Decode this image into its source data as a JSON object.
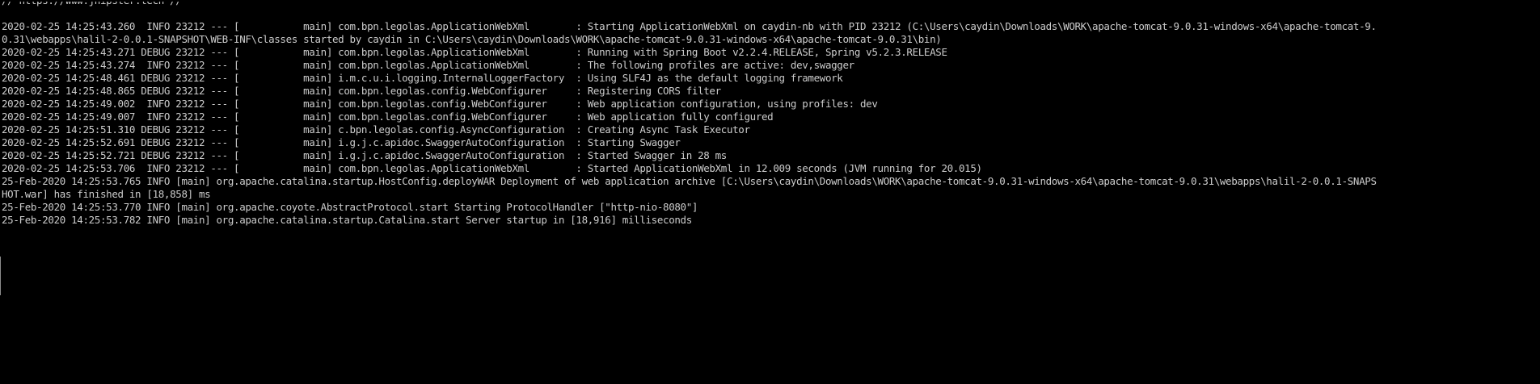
{
  "console": {
    "lines": [
      "// https://www.jhipster.tech //",
      "",
      "2020-02-25 14:25:43.260  INFO 23212 --- [           main] com.bpn.legolas.ApplicationWebXml        : Starting ApplicationWebXml on caydin-nb with PID 23212 (C:\\Users\\caydin\\Downloads\\WORK\\apache-tomcat-9.0.31-windows-x64\\apache-tomcat-9.",
      "0.31\\webapps\\halil-2-0.0.1-SNAPSHOT\\WEB-INF\\classes started by caydin in C:\\Users\\caydin\\Downloads\\WORK\\apache-tomcat-9.0.31-windows-x64\\apache-tomcat-9.0.31\\bin)",
      "2020-02-25 14:25:43.271 DEBUG 23212 --- [           main] com.bpn.legolas.ApplicationWebXml        : Running with Spring Boot v2.2.4.RELEASE, Spring v5.2.3.RELEASE",
      "2020-02-25 14:25:43.274  INFO 23212 --- [           main] com.bpn.legolas.ApplicationWebXml        : The following profiles are active: dev,swagger",
      "2020-02-25 14:25:48.461 DEBUG 23212 --- [           main] i.m.c.u.i.logging.InternalLoggerFactory  : Using SLF4J as the default logging framework",
      "2020-02-25 14:25:48.865 DEBUG 23212 --- [           main] com.bpn.legolas.config.WebConfigurer     : Registering CORS filter",
      "2020-02-25 14:25:49.002  INFO 23212 --- [           main] com.bpn.legolas.config.WebConfigurer     : Web application configuration, using profiles: dev",
      "2020-02-25 14:25:49.007  INFO 23212 --- [           main] com.bpn.legolas.config.WebConfigurer     : Web application fully configured",
      "2020-02-25 14:25:51.310 DEBUG 23212 --- [           main] c.bpn.legolas.config.AsyncConfiguration  : Creating Async Task Executor",
      "2020-02-25 14:25:52.691 DEBUG 23212 --- [           main] i.g.j.c.apidoc.SwaggerAutoConfiguration  : Starting Swagger",
      "2020-02-25 14:25:52.721 DEBUG 23212 --- [           main] i.g.j.c.apidoc.SwaggerAutoConfiguration  : Started Swagger in 28 ms",
      "2020-02-25 14:25:53.706  INFO 23212 --- [           main] com.bpn.legolas.ApplicationWebXml        : Started ApplicationWebXml in 12.009 seconds (JVM running for 20.015)",
      "25-Feb-2020 14:25:53.765 INFO [main] org.apache.catalina.startup.HostConfig.deployWAR Deployment of web application archive [C:\\Users\\caydin\\Downloads\\WORK\\apache-tomcat-9.0.31-windows-x64\\apache-tomcat-9.0.31\\webapps\\halil-2-0.0.1-SNAPS",
      "HOT.war] has finished in [18,858] ms",
      "25-Feb-2020 14:25:53.770 INFO [main] org.apache.coyote.AbstractProtocol.start Starting ProtocolHandler [\"http-nio-8080\"]",
      "25-Feb-2020 14:25:53.782 INFO [main] org.apache.catalina.startup.Catalina.start Server startup in [18,916] milliseconds"
    ]
  }
}
